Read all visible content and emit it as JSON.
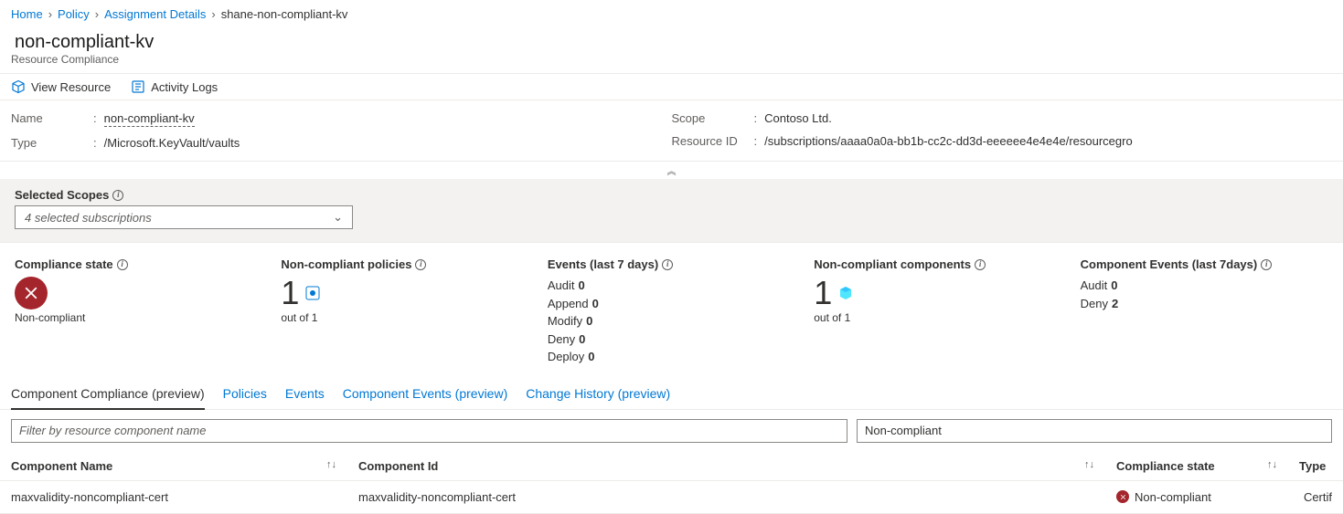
{
  "breadcrumb": {
    "items": [
      "Home",
      "Policy",
      "Assignment Details"
    ],
    "current": "shane-non-compliant-kv"
  },
  "header": {
    "title": "non-compliant-kv",
    "subtitle": "Resource Compliance"
  },
  "toolbar": {
    "viewResource": "View Resource",
    "activityLogs": "Activity Logs"
  },
  "props": {
    "left": {
      "nameLabel": "Name",
      "nameValue": "non-compliant-kv",
      "typeLabel": "Type",
      "typeValue": "/Microsoft.KeyVault/vaults"
    },
    "right": {
      "scopeLabel": "Scope",
      "scopeValue": "Contoso Ltd.",
      "resIdLabel": "Resource ID",
      "resIdValue": "/subscriptions/aaaa0a0a-bb1b-cc2c-dd3d-eeeeee4e4e4e/resourcegro"
    }
  },
  "scopes": {
    "label": "Selected Scopes",
    "selected": "4 selected subscriptions"
  },
  "stats": {
    "compliance": {
      "title": "Compliance state",
      "value": "Non-compliant"
    },
    "policies": {
      "title": "Non-compliant policies",
      "big": "1",
      "sub": "out of 1"
    },
    "events": {
      "title": "Events (last 7 days)",
      "lines": [
        {
          "label": "Audit",
          "val": "0"
        },
        {
          "label": "Append",
          "val": "0"
        },
        {
          "label": "Modify",
          "val": "0"
        },
        {
          "label": "Deny",
          "val": "0"
        },
        {
          "label": "Deploy",
          "val": "0"
        }
      ]
    },
    "components": {
      "title": "Non-compliant components",
      "big": "1",
      "sub": "out of 1"
    },
    "compEvents": {
      "title": "Component Events (last 7days)",
      "lines": [
        {
          "label": "Audit",
          "val": "0"
        },
        {
          "label": "Deny",
          "val": "2"
        }
      ]
    }
  },
  "tabs": {
    "items": [
      {
        "label": "Component Compliance (preview)",
        "active": true
      },
      {
        "label": "Policies",
        "active": false
      },
      {
        "label": "Events",
        "active": false
      },
      {
        "label": "Component Events (preview)",
        "active": false
      },
      {
        "label": "Change History (preview)",
        "active": false
      }
    ]
  },
  "filters": {
    "placeholder": "Filter by resource component name",
    "stateFilter": "Non-compliant"
  },
  "table": {
    "cols": {
      "name": "Component Name",
      "id": "Component Id",
      "state": "Compliance state",
      "type": "Type"
    },
    "rows": [
      {
        "name": "maxvalidity-noncompliant-cert",
        "id": "maxvalidity-noncompliant-cert",
        "state": "Non-compliant",
        "type": "Certif"
      }
    ]
  }
}
